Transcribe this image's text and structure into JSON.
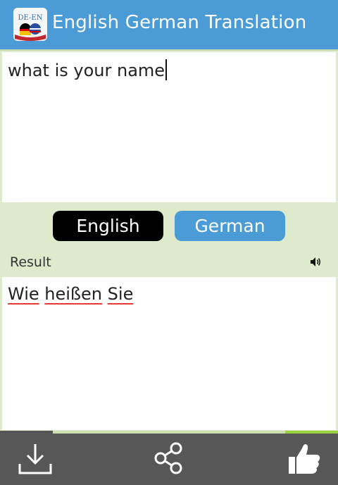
{
  "app": {
    "title": "English German Translation",
    "logo_text": "DE-EN"
  },
  "input": {
    "value": "what is your name"
  },
  "languages": {
    "source_label": "English",
    "target_label": "German"
  },
  "result": {
    "label": "Result",
    "words": [
      "Wie",
      "heißen",
      "Sie"
    ]
  },
  "colors": {
    "appbar": "#4a9bd6",
    "background": "#dfeacc",
    "source_button": "#000000",
    "target_button": "#4a9bd6",
    "bottombar": "#575757",
    "spell_underline": "#e53935"
  },
  "icons": {
    "speaker": "speaker-icon",
    "download": "download-icon",
    "share": "share-icon",
    "like": "thumbs-up-icon"
  }
}
